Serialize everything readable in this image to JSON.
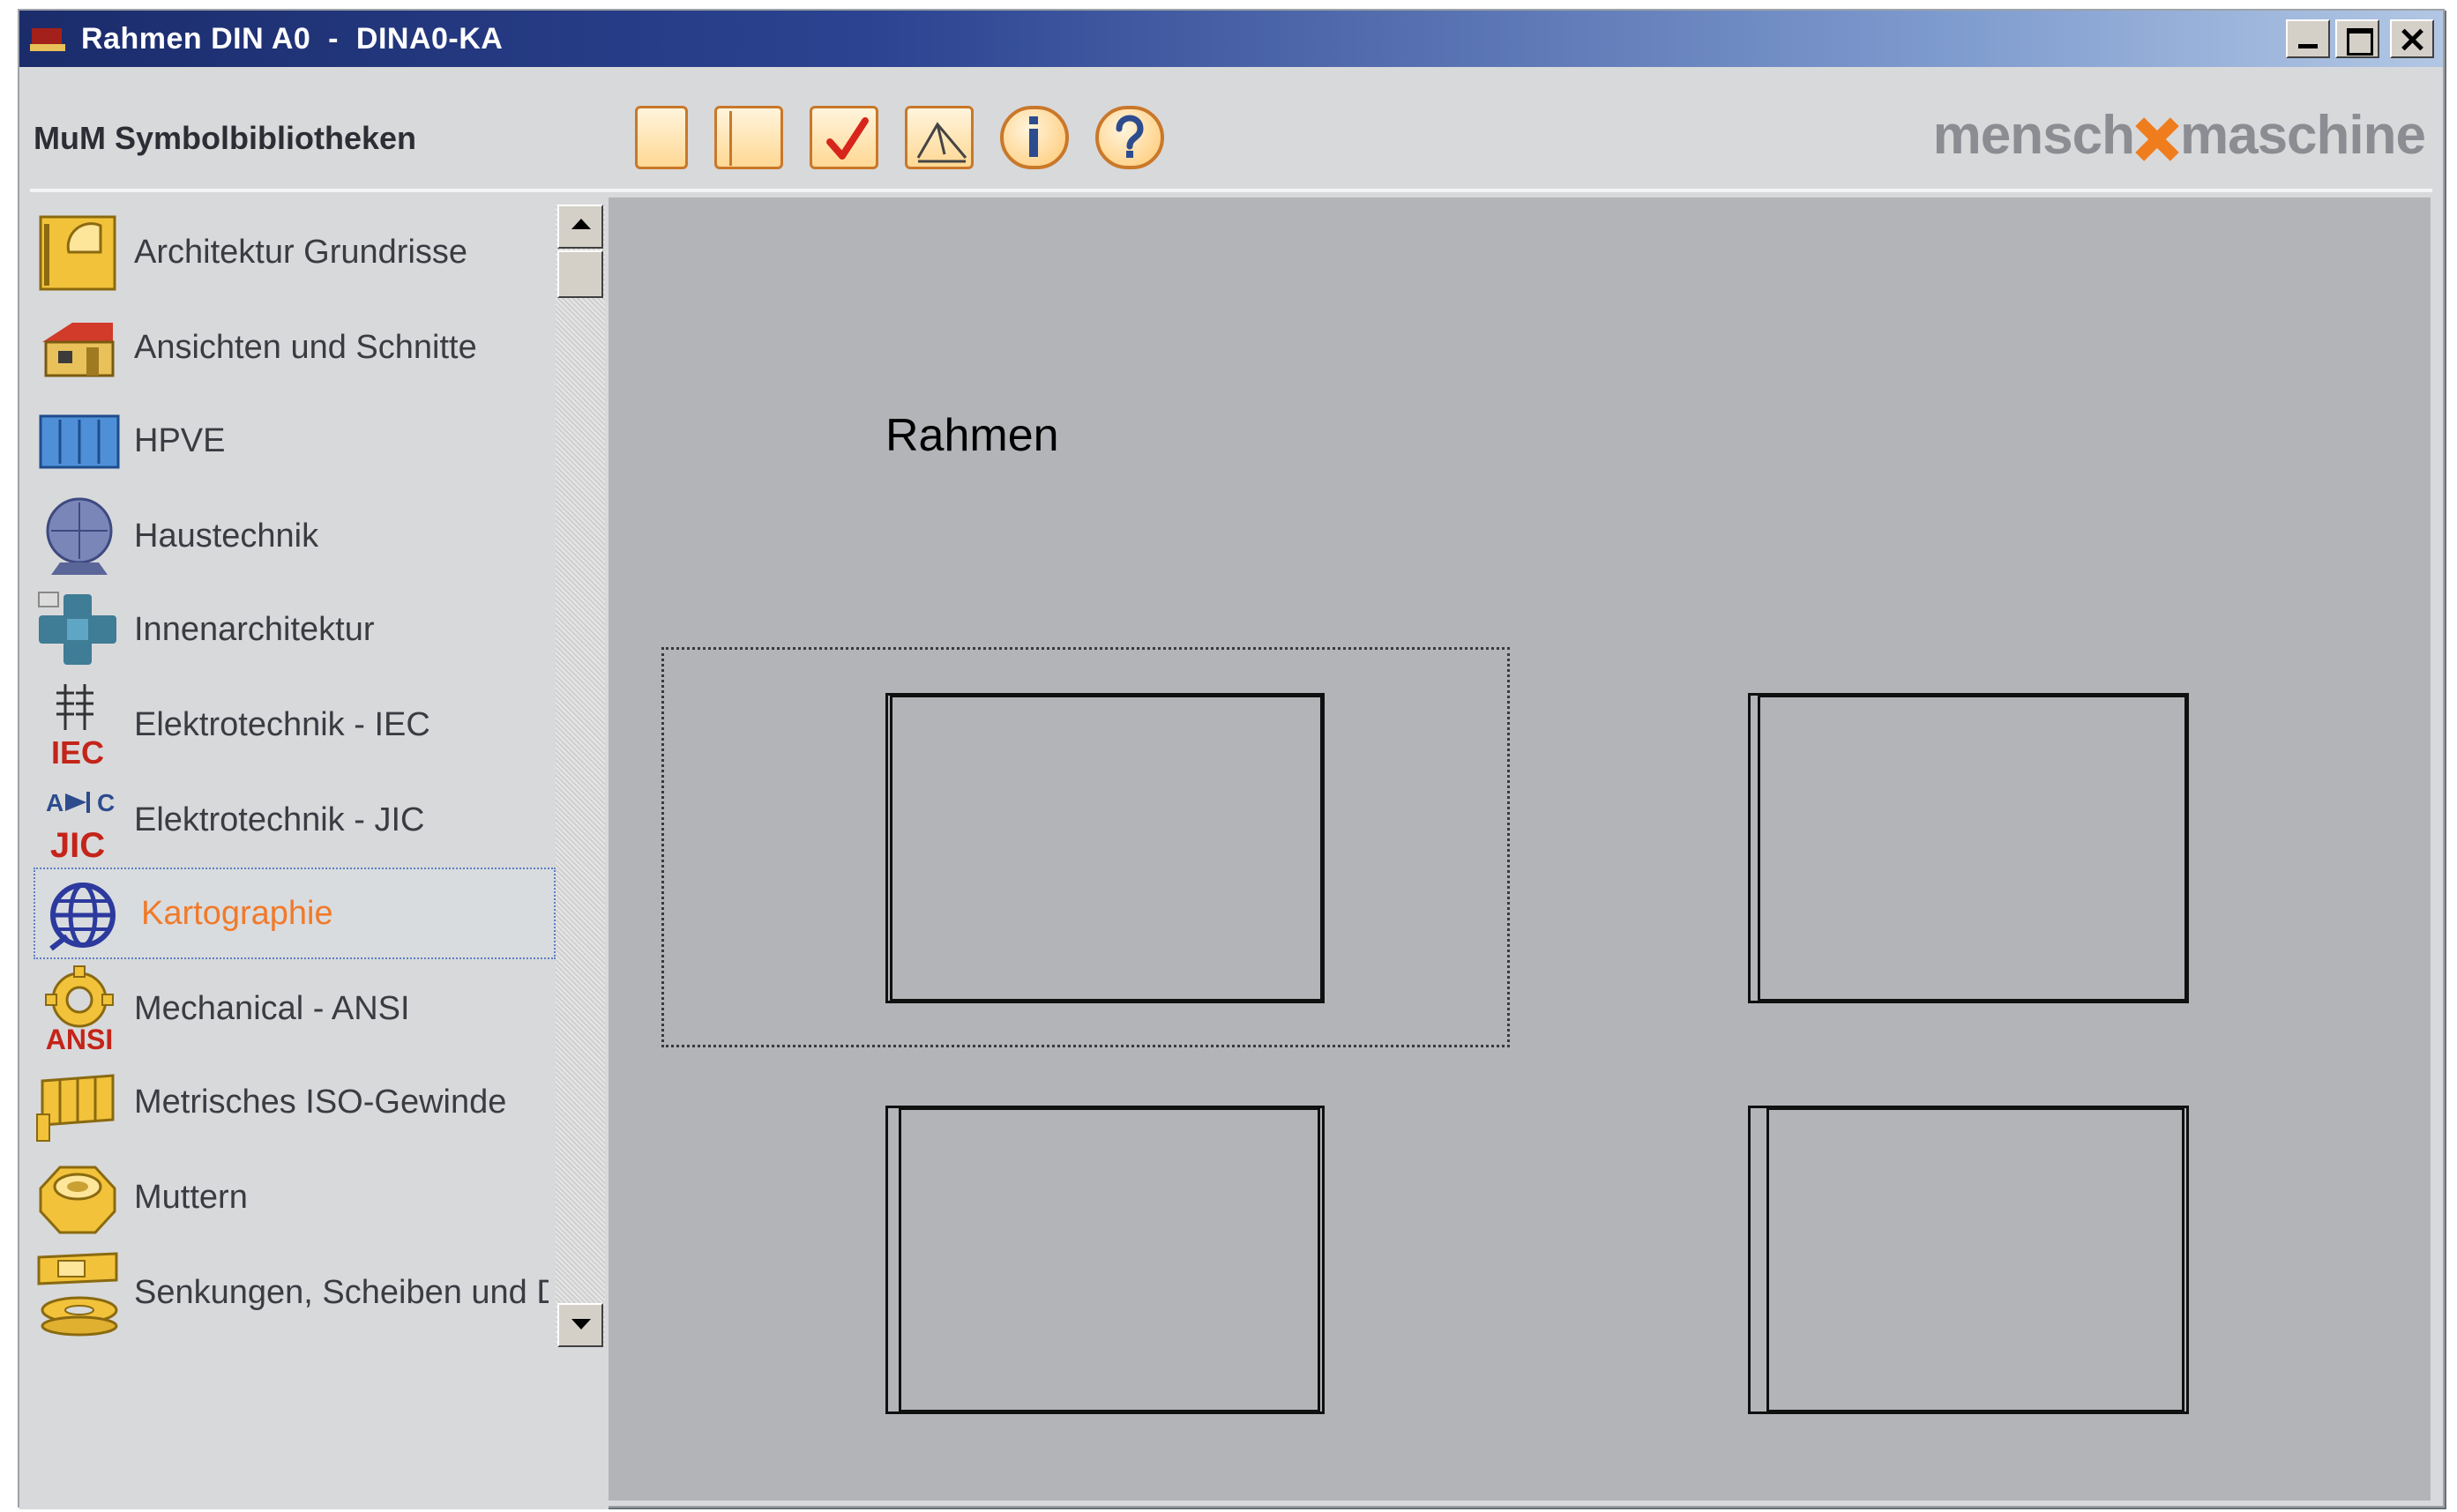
{
  "window": {
    "title": "Rahmen DIN A0  -  DINA0-KA",
    "controls": [
      "minimize",
      "maximize",
      "close"
    ]
  },
  "header": {
    "app_label": "MuM Symbolbibliotheken",
    "brand_left": "mensch",
    "brand_right": "maschine",
    "brand_accent": "#ef7d1e",
    "toolbar": [
      {
        "icon": "new-page-icon"
      },
      {
        "icon": "open-book-icon"
      },
      {
        "icon": "check-icon"
      },
      {
        "icon": "edit-page-icon"
      },
      {
        "icon": "info-icon"
      },
      {
        "icon": "help-icon"
      }
    ]
  },
  "sidebar": {
    "items": [
      {
        "label": "Architektur Grundrisse",
        "icon": "floorplan-icon"
      },
      {
        "label": "Ansichten und Schnitte",
        "icon": "house-icon"
      },
      {
        "label": "HPVE",
        "icon": "hpve-icon"
      },
      {
        "label": "Haustechnik",
        "icon": "fan-icon"
      },
      {
        "label": "Innenarchitektur",
        "icon": "furniture-icon"
      },
      {
        "label": "Elektrotechnik - IEC",
        "icon": "iec-icon",
        "icon_text": "IEC"
      },
      {
        "label": "Elektrotechnik - JIC",
        "icon": "jic-icon",
        "icon_text": "JIC"
      },
      {
        "label": "Kartographie",
        "icon": "globe-icon",
        "selected": true
      },
      {
        "label": "Mechanical - ANSI",
        "icon": "gear-icon",
        "icon_text": "ANSI"
      },
      {
        "label": "Metrisches ISO-Gewinde",
        "icon": "thread-icon"
      },
      {
        "label": "Muttern",
        "icon": "nut-icon"
      },
      {
        "label": "Senkungen, Scheiben und Du",
        "icon": "washer-icon"
      }
    ],
    "selected_color": "#f07a2a"
  },
  "preview": {
    "title": "Rahmen",
    "frames": [
      "frame-1",
      "frame-2",
      "frame-3",
      "frame-4"
    ]
  }
}
